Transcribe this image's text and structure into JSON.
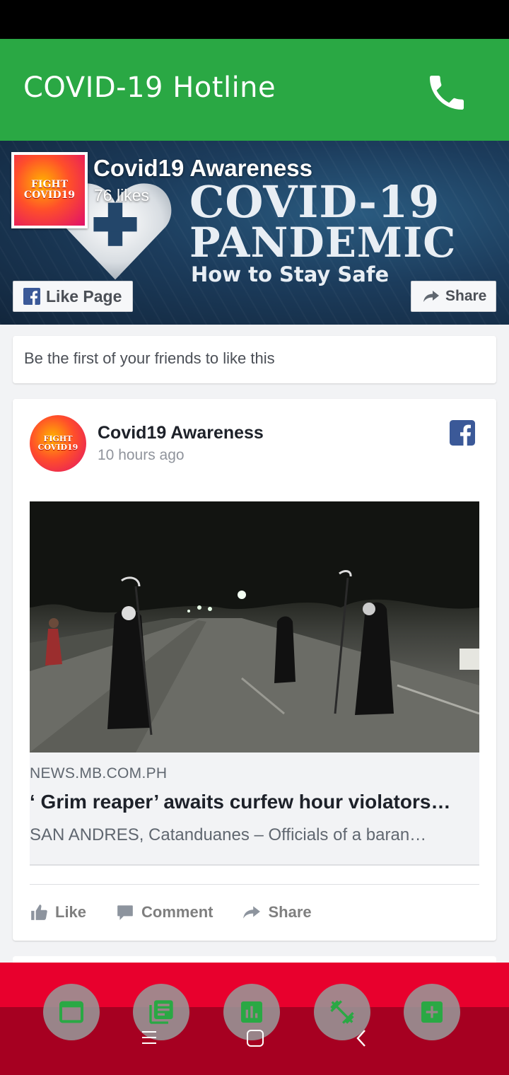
{
  "app": {
    "title": "COVID-19 Hotline"
  },
  "page": {
    "name": "Covid19 Awareness",
    "likes": "76 likes",
    "like_button": "Like Page",
    "share_button": "Share",
    "logo_text": [
      "FIGHT",
      "COVID19"
    ],
    "cover": {
      "line1": "COVID-19",
      "line2": "PANDEMIC",
      "line3": "How to Stay Safe"
    }
  },
  "friends_notice": "Be the first of your friends to like this",
  "post": {
    "author": "Covid19 Awareness",
    "time": "10 hours ago",
    "link": {
      "domain": "NEWS.MB.COM.PH",
      "headline": "‘ Grim reaper’ awaits curfew hour violators…",
      "description": "SAN ANDRES, Catanduanes – Officials of a baran…"
    },
    "actions": {
      "like": "Like",
      "comment": "Comment",
      "share": "Share"
    }
  },
  "bottom_nav": {
    "items": [
      "window-icon",
      "news-icon",
      "stats-icon",
      "fitness-icon",
      "medical-cross-icon"
    ],
    "icon_color": "#2aa844"
  },
  "colors": {
    "appbar": "#2aa844",
    "nav_red": "#e8002d",
    "nav_dark": "#a60021",
    "facebook": "#3b5998"
  }
}
